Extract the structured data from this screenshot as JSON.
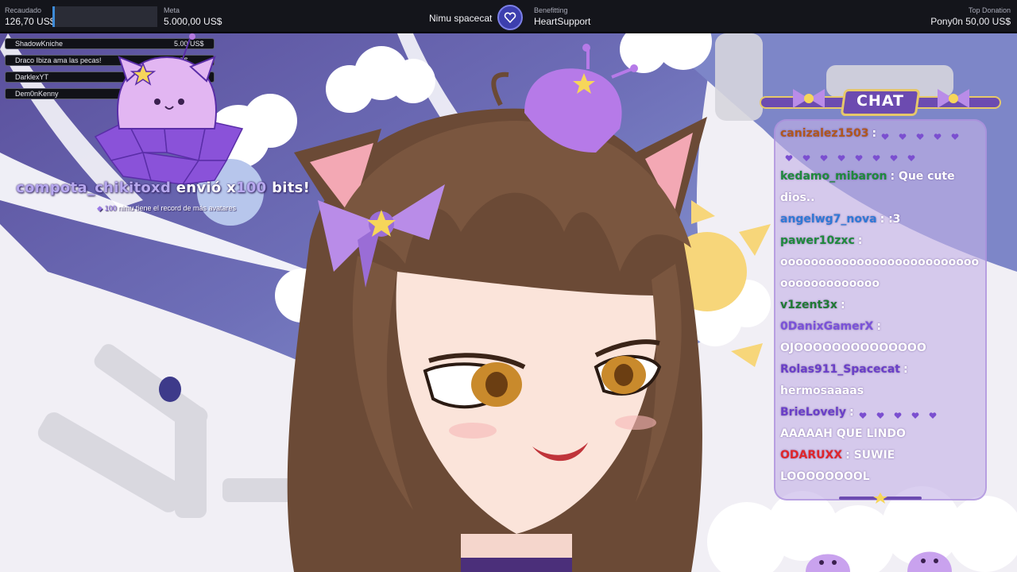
{
  "topbar": {
    "raised_label": "Recaudado",
    "raised_value": "126,70 US$",
    "goal_label": "Meta",
    "goal_value": "5.000,00 US$",
    "goal_progress": 0.025,
    "streamer": "Nimu spacecat",
    "charity_label": "Benefitting",
    "charity_name": "HeartSupport",
    "top_donation_label": "Top Donation",
    "top_donation_value": "Pony0n 50,00 US$"
  },
  "donors": [
    {
      "name": "ShadowKniche",
      "amount": "5.00 US$"
    },
    {
      "name": "Draco Ibiza ama las pecas!",
      "amount": "US$"
    },
    {
      "name": "DarklexYT",
      "amount": ""
    },
    {
      "name": "Dem0nKenny",
      "amount": ""
    }
  ],
  "alert": {
    "user": "compota_chikitoxd",
    "verb": "envió x",
    "amount": "100",
    "unit": "bits!",
    "sub_amount": "100",
    "sub_text": "nimu tiene el record de más avatares"
  },
  "chat": {
    "title": "CHAT",
    "messages": [
      {
        "name": "canizalez1503",
        "color": "#b0571e",
        "text": ":",
        "hearts": 5
      },
      {
        "name": "",
        "color": "#ffffff",
        "text": "",
        "hearts": 8
      },
      {
        "name": "kedamo_mibaron",
        "color": "#1f8a3c",
        "text": ": Que cute",
        "hearts": 0
      },
      {
        "name": "",
        "color": "#ffffff",
        "text": "dios..",
        "hearts": 0
      },
      {
        "name": "angelwg7_nova",
        "color": "#2f79d6",
        "text": ": :3",
        "hearts": 0
      },
      {
        "name": "pawer10zxc",
        "color": "#1f8a3c",
        "text": ":",
        "hearts": 0
      },
      {
        "name": "",
        "color": "#ffffff",
        "text": "oooooooooooooooooooooooooo",
        "hearts": 0
      },
      {
        "name": "",
        "color": "#ffffff",
        "text": "ooooooooooooo",
        "hearts": 0
      },
      {
        "name": "v1zent3x",
        "color": "#1f7a33",
        "text": ":",
        "hearts": 0
      },
      {
        "name": "0DanixGamerX",
        "color": "#7a52d9",
        "text": ":",
        "hearts": 0
      },
      {
        "name": "",
        "color": "#ffffff",
        "text": "OJOOOOOOOOOOOOOO",
        "hearts": 0
      },
      {
        "name": "Rolas911_Spacecat",
        "color": "#6a3fc8",
        "text": ":",
        "hearts": 0
      },
      {
        "name": "",
        "color": "#ffffff",
        "text": "hermosaaaas",
        "hearts": 0
      },
      {
        "name": "BrieLovely",
        "color": "#6a3fc8",
        "text": ":",
        "hearts": 5
      },
      {
        "name": "",
        "color": "#ffffff",
        "text": "AAAAAH QUE LINDO",
        "hearts": 0
      },
      {
        "name": "ODARUXX",
        "color": "#e0262b",
        "text": ": SUWIE",
        "hearts": 0
      },
      {
        "name": "",
        "color": "#ffffff",
        "text": "LOOOOOOOOL",
        "hearts": 0
      }
    ]
  },
  "colors": {
    "accent_purple": "#6c4bb0",
    "gold": "#e6c86a",
    "heart": "#7b4fd0",
    "hair": "#6b4a36"
  }
}
